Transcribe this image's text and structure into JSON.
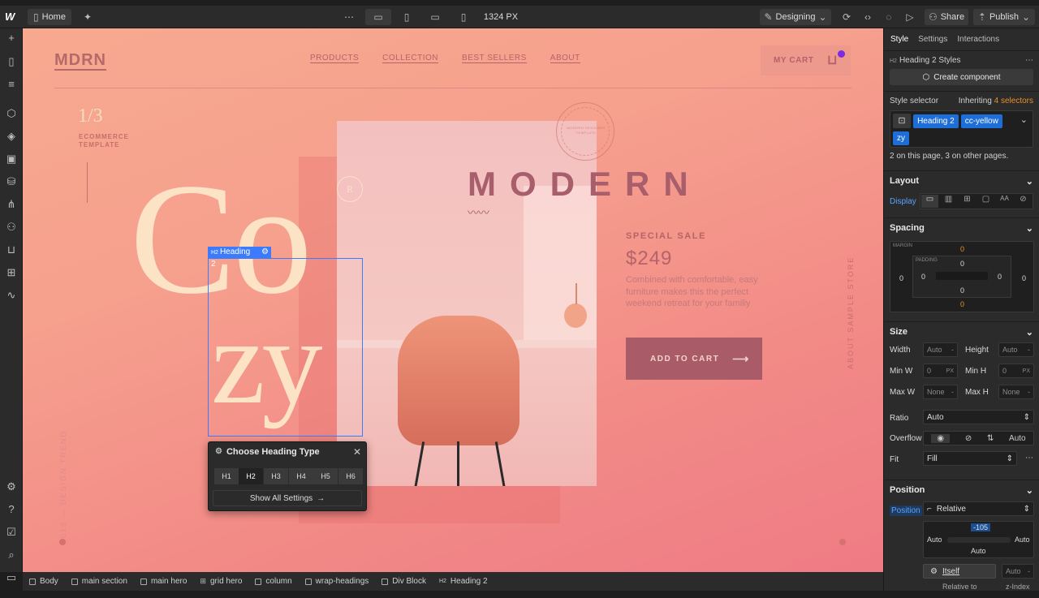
{
  "topbar": {
    "home_label": "Home",
    "width_readout": "1324 PX",
    "mode_label": "Designing",
    "share_label": "Share",
    "publish_label": "Publish"
  },
  "site": {
    "logo": "MDRN",
    "nav": [
      "PRODUCTS",
      "COLLECTION",
      "BEST SELLERS",
      "ABOUT"
    ],
    "cart_label": "MY CART",
    "counter": "1/3",
    "template_line1": "ECOMMERCE",
    "template_line2": "TEMPLATE",
    "cozy_line1": "Co",
    "cozy_line2": "zy",
    "modern": "MODERN",
    "sale_label": "SPECIAL SALE",
    "price": "$249",
    "description": "Combined with comfortable, easy furniture makes this the perfect weekend retreat for your familiy",
    "add_to_cart": "ADD TO CART",
    "side_right": "ABOUT SAMPLE STORE",
    "side_left": "2019 — DESIGN TREND",
    "badge_letter": "R",
    "stamp_text": "MODERN DESIGNER TEMPLATE"
  },
  "selection": {
    "label": "Heading 2"
  },
  "popup": {
    "title": "Choose Heading Type",
    "buttons": [
      "H1",
      "H2",
      "H3",
      "H4",
      "H5",
      "H6"
    ],
    "show_all": "Show All Settings"
  },
  "breadcrumbs": [
    "Body",
    "main section",
    "main hero",
    "grid hero",
    "column",
    "wrap-headings",
    "Div Block",
    "Heading 2"
  ],
  "panel": {
    "tabs": [
      "Style",
      "Settings",
      "Interactions"
    ],
    "styles_title": "Heading 2 Styles",
    "create_component": "Create component",
    "style_selector_label": "Style selector",
    "inheriting_prefix": "Inheriting",
    "inheriting_count": "4 selectors",
    "selectors": [
      "Heading 2",
      "cc-yellow",
      "zy"
    ],
    "on_page_text": "2 on this page, 3 on other pages.",
    "layout_title": "Layout",
    "display_label": "Display",
    "spacing_title": "Spacing",
    "margin_label": "MARGIN",
    "padding_label": "PADDING",
    "margin_top": "0",
    "margin_left": "0",
    "margin_right": "0",
    "margin_bottom": "0",
    "padding_top": "0",
    "padding_left": "0",
    "padding_right": "0",
    "padding_bottom": "0",
    "size_title": "Size",
    "width_label": "Width",
    "width_value": "Auto",
    "height_label": "Height",
    "height_value": "Auto",
    "minw_label": "Min W",
    "minw_value": "0",
    "minh_label": "Min H",
    "minh_value": "0",
    "maxw_label": "Max W",
    "maxw_value": "None",
    "maxh_label": "Max H",
    "maxh_value": "None",
    "unit_px": "PX",
    "ratio_label": "Ratio",
    "ratio_value": "Auto",
    "overflow_label": "Overflow",
    "overflow_auto": "Auto",
    "fit_label": "Fit",
    "fit_value": "Fill",
    "position_title": "Position",
    "position_label": "Position",
    "position_value": "Relative",
    "pos_top": "-105",
    "pos_left": "Auto",
    "pos_right": "Auto",
    "pos_bottom": "Auto",
    "relative_to_label": "Relative to",
    "relative_to_value": "Itself",
    "zindex_label": "z-Index",
    "zindex_value": "Auto"
  },
  "colors": {
    "accent": "#3d7bfd",
    "cream": "#fde3c6",
    "mauve": "#a35a67"
  }
}
